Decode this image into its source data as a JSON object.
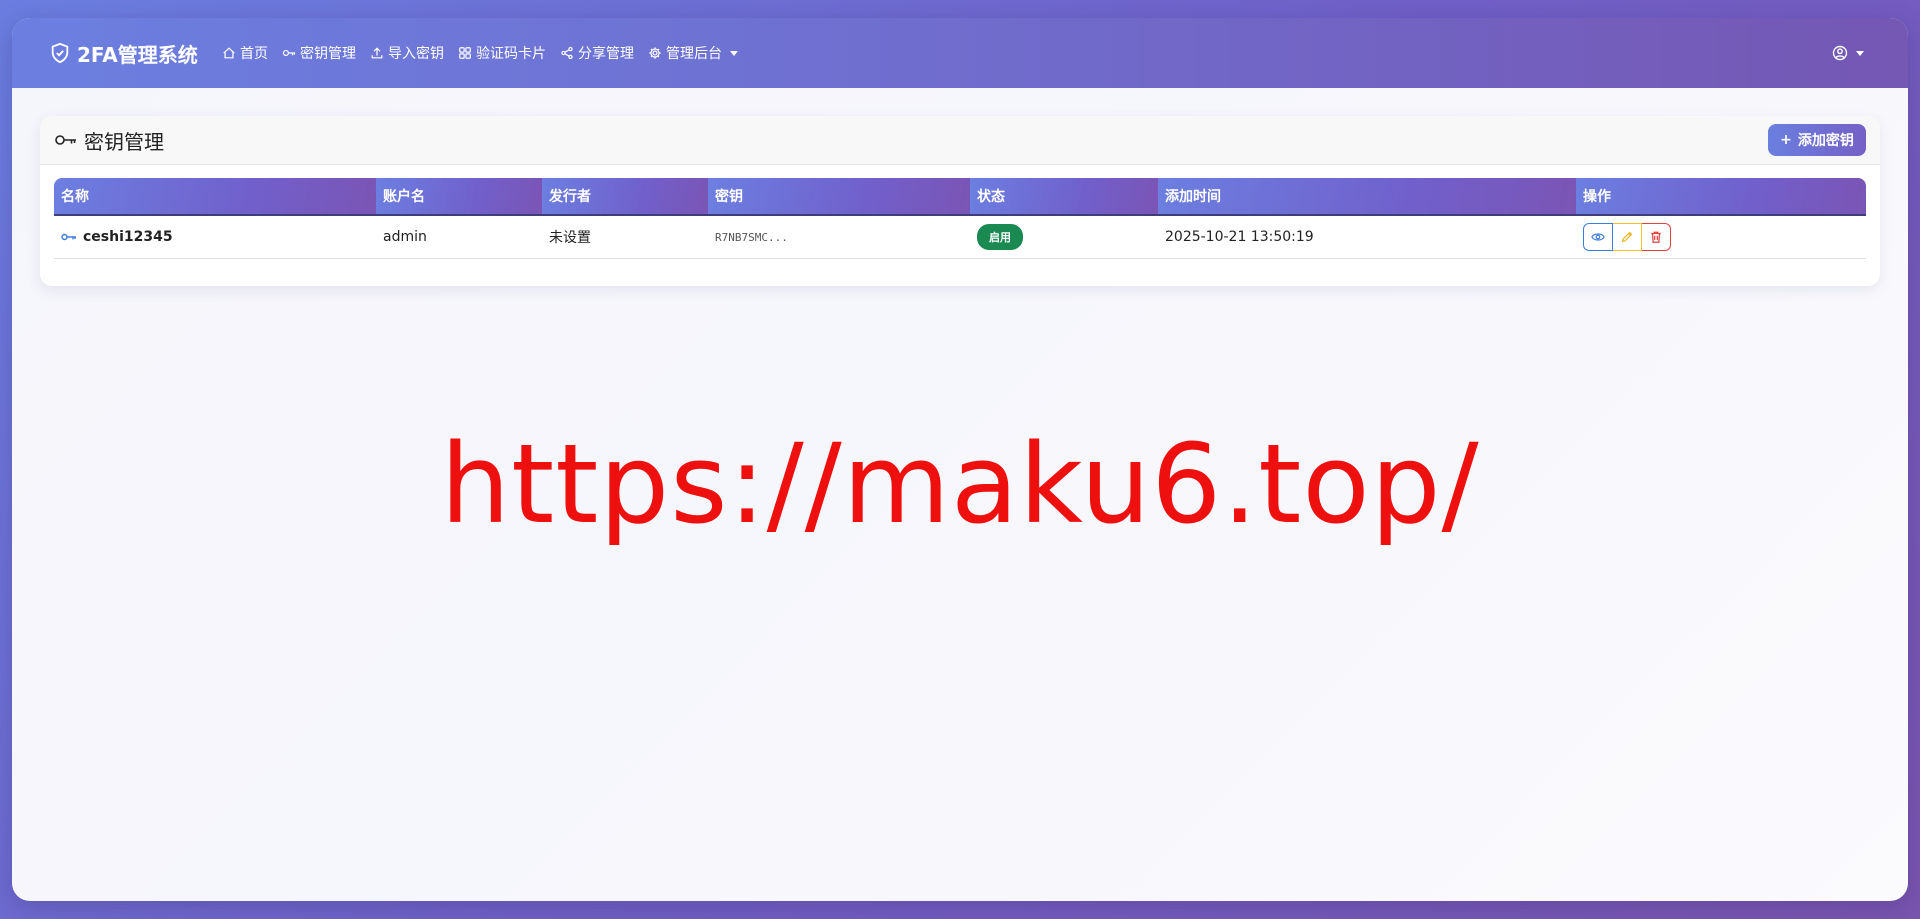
{
  "brand": {
    "title": "2FA管理系统",
    "icon": "shield-check-icon"
  },
  "nav": {
    "items": [
      {
        "label": "首页",
        "icon": "home-icon"
      },
      {
        "label": "密钥管理",
        "icon": "key-icon"
      },
      {
        "label": "导入密钥",
        "icon": "upload-icon"
      },
      {
        "label": "验证码卡片",
        "icon": "grid-icon"
      },
      {
        "label": "分享管理",
        "icon": "share-icon"
      },
      {
        "label": "管理后台",
        "icon": "gear-icon",
        "dropdown": true
      }
    ]
  },
  "user_menu": {
    "icon": "user-circle-icon"
  },
  "card": {
    "title": "密钥管理",
    "add_button": "添加密钥"
  },
  "table": {
    "columns": [
      "名称",
      "账户名",
      "发行者",
      "密钥",
      "状态",
      "添加时间",
      "操作"
    ],
    "rows": [
      {
        "name": "ceshi12345",
        "account": "admin",
        "issuer": "未设置",
        "secret": "R7NB7SMC...",
        "status": "启用",
        "added": "2025-10-21 13:50:19"
      }
    ]
  },
  "colors": {
    "accent_start": "#6c7fe0",
    "accent_end": "#7557b4",
    "status_active": "#1b8a52",
    "view_btn": "#3b7ddd",
    "edit_btn": "#f2c12e",
    "delete_btn": "#e04040",
    "watermark": "#ee0f0f"
  },
  "watermark": {
    "text": "https://maku6.top/"
  }
}
